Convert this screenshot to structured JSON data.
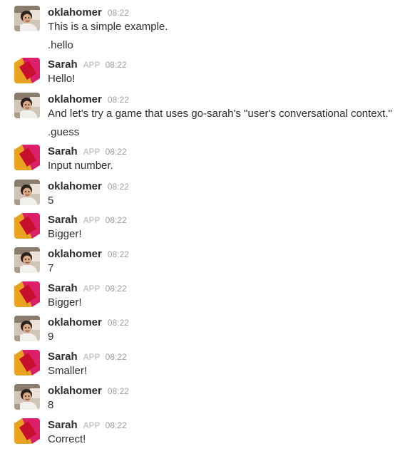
{
  "conversation": {
    "messages": [
      {
        "author": "oklahomer",
        "is_app": false,
        "time": "08:22",
        "lines": [
          "This is a simple example.",
          ".hello"
        ]
      },
      {
        "author": "Sarah",
        "is_app": true,
        "app_badge": "APP",
        "time": "08:22",
        "lines": [
          "Hello!"
        ]
      },
      {
        "author": "oklahomer",
        "is_app": false,
        "time": "08:22",
        "lines": [
          "And let's try a game that uses go-sarah's \"user's conversational context.\"",
          ".guess"
        ]
      },
      {
        "author": "Sarah",
        "is_app": true,
        "app_badge": "APP",
        "time": "08:22",
        "lines": [
          "Input number."
        ]
      },
      {
        "author": "oklahomer",
        "is_app": false,
        "time": "08:22",
        "lines": [
          "5"
        ]
      },
      {
        "author": "Sarah",
        "is_app": true,
        "app_badge": "APP",
        "time": "08:22",
        "lines": [
          "Bigger!"
        ]
      },
      {
        "author": "oklahomer",
        "is_app": false,
        "time": "08:22",
        "lines": [
          "7"
        ]
      },
      {
        "author": "Sarah",
        "is_app": true,
        "app_badge": "APP",
        "time": "08:22",
        "lines": [
          "Bigger!"
        ]
      },
      {
        "author": "oklahomer",
        "is_app": false,
        "time": "08:22",
        "lines": [
          "9"
        ]
      },
      {
        "author": "Sarah",
        "is_app": true,
        "app_badge": "APP",
        "time": "08:22",
        "lines": [
          "Smaller!"
        ]
      },
      {
        "author": "oklahomer",
        "is_app": false,
        "time": "08:22",
        "lines": [
          "8"
        ]
      },
      {
        "author": "Sarah",
        "is_app": true,
        "app_badge": "APP",
        "time": "08:22",
        "lines": [
          "Correct!"
        ]
      }
    ]
  },
  "colors": {
    "author_text": "#2c2d30",
    "timestamp": "#9e9ea6",
    "app_badge": "#b0b0b3",
    "sarah_logo_orange": "#e8a320",
    "sarah_logo_pink": "#dd1f6a",
    "sarah_logo_red": "#c8102e"
  },
  "icons": {
    "user_avatar": "oklahomer-photo-avatar",
    "app_avatar": "sarah-logo-avatar"
  }
}
